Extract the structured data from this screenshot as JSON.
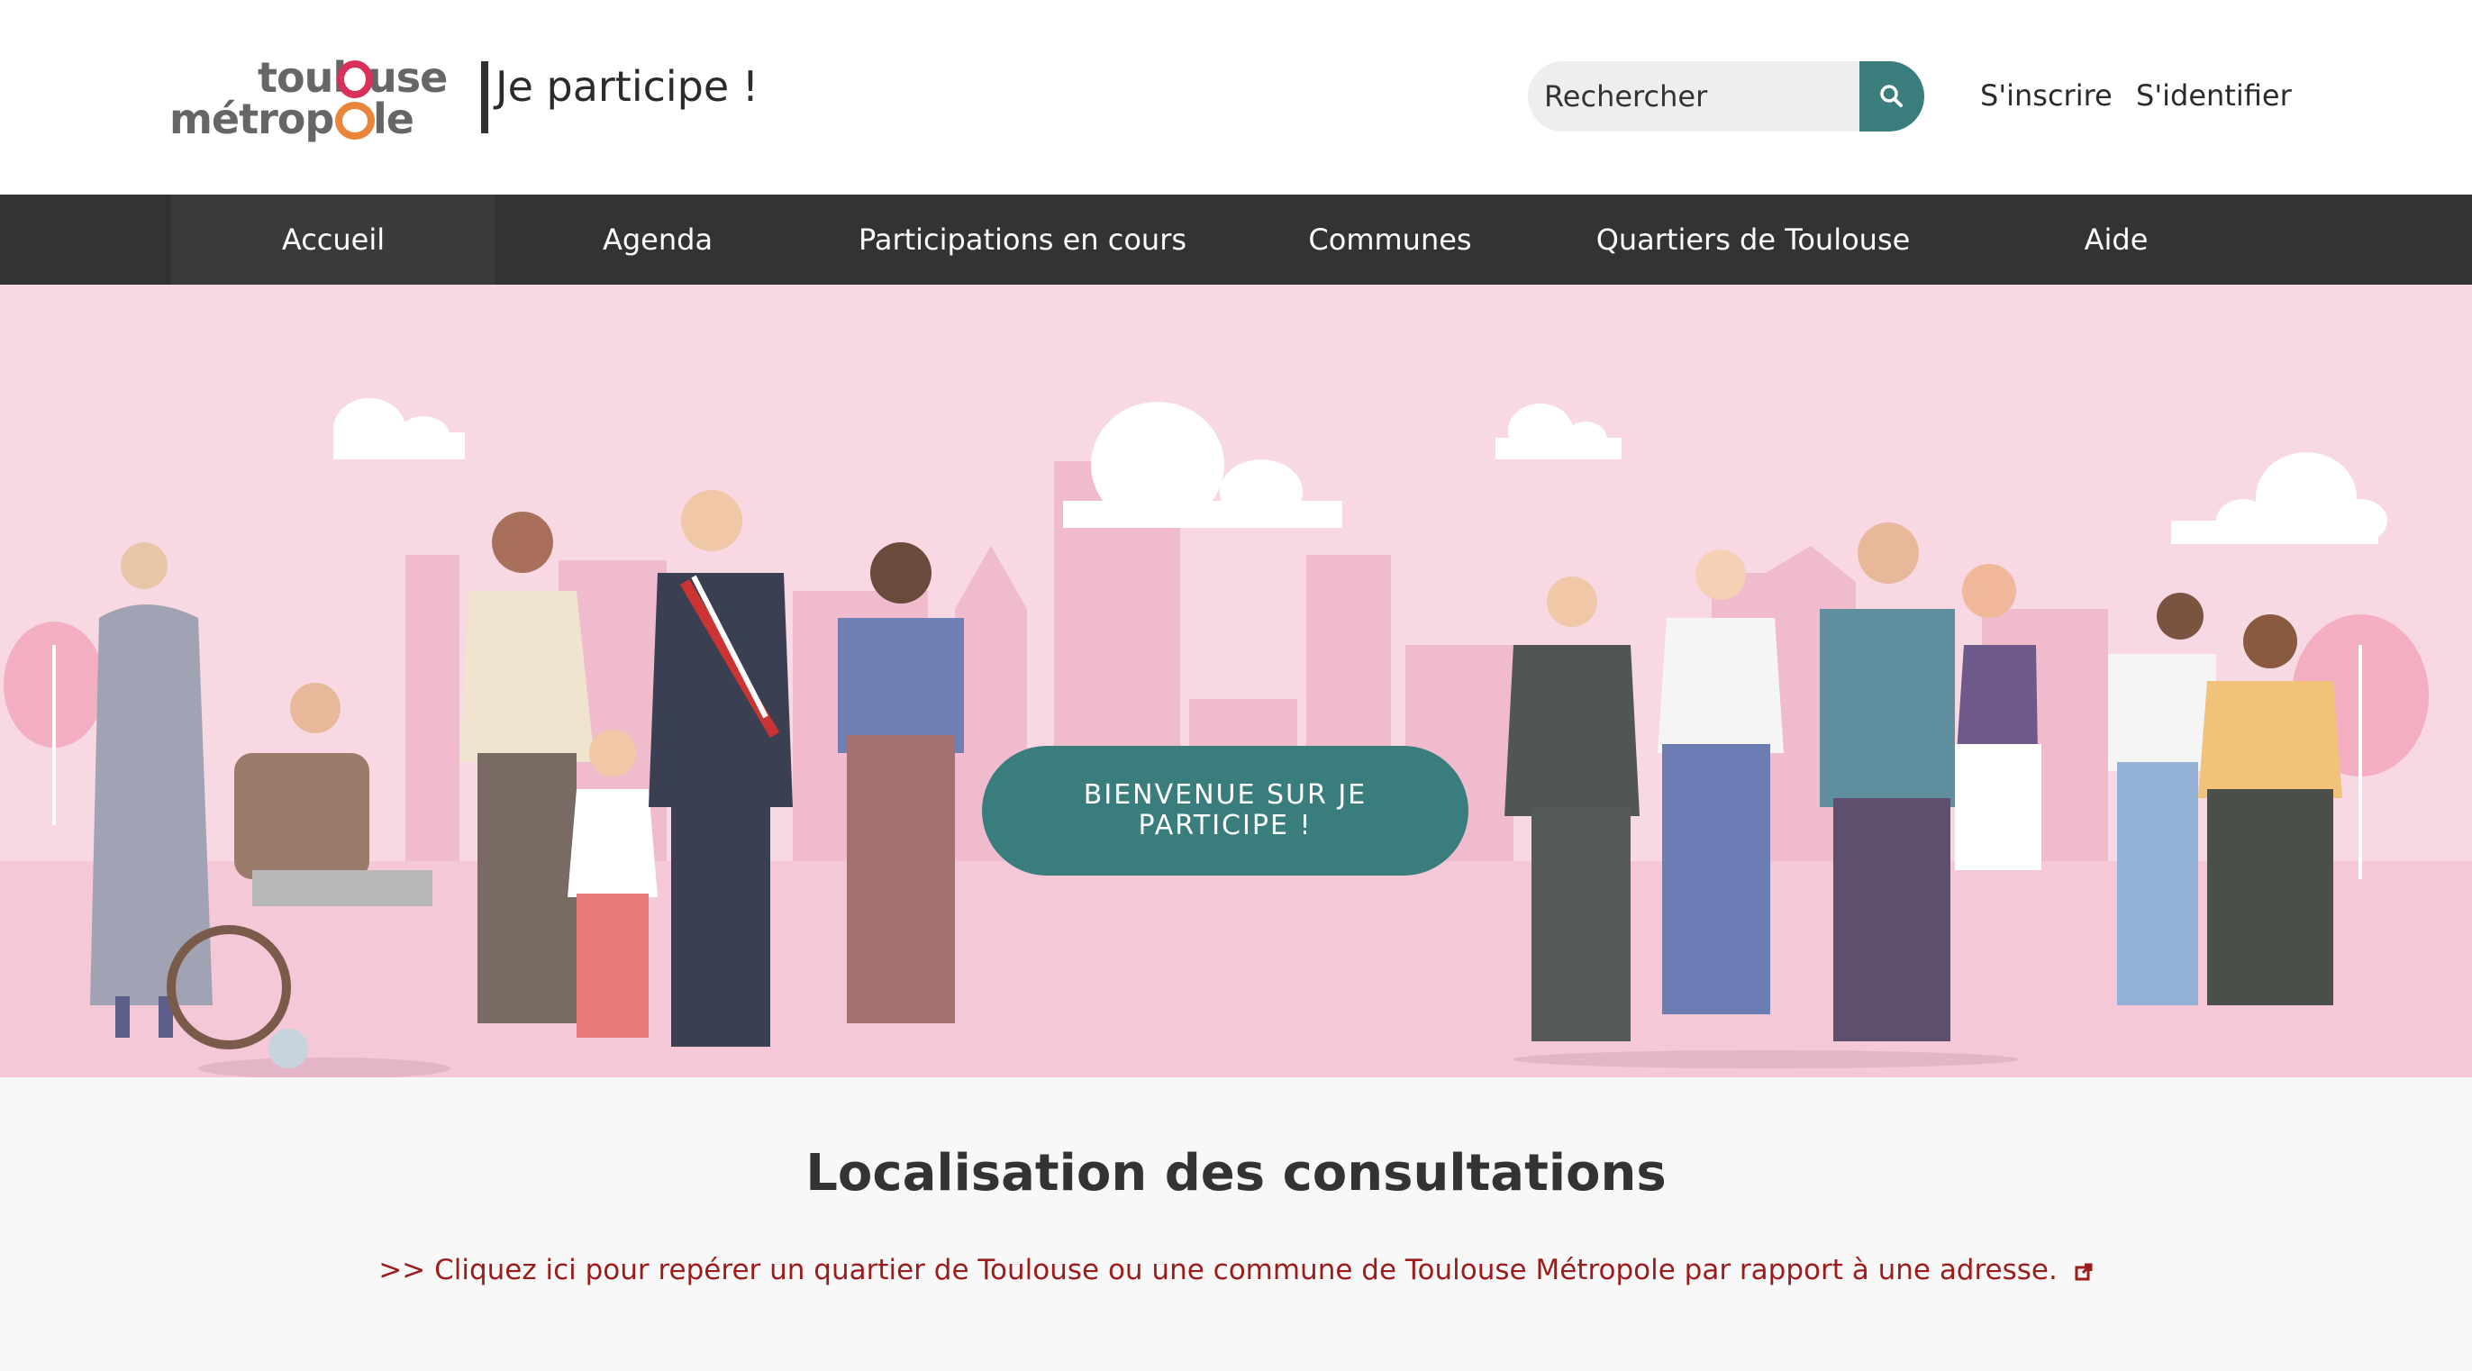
{
  "header": {
    "logo": {
      "line1": "toulouse",
      "line2": "métropole"
    },
    "site_title": "Je participe !",
    "search": {
      "placeholder": "Rechercher",
      "icon": "search-icon"
    },
    "auth": {
      "register": "S'inscrire",
      "login": "S'identifier"
    }
  },
  "nav": {
    "items": [
      {
        "label": "Accueil",
        "active": true
      },
      {
        "label": "Agenda"
      },
      {
        "label": "Participations en cours"
      },
      {
        "label": "Communes"
      },
      {
        "label": "Quartiers de Toulouse"
      },
      {
        "label": "Aide"
      }
    ]
  },
  "hero": {
    "button_label": "BIENVENUE SUR JE PARTICIPE !",
    "illustration": "group-of-diverse-people-illustration"
  },
  "section": {
    "title": "Localisation des consultations",
    "link_text": ">> Cliquez ici pour repérer un quartier de Toulouse ou une commune de Toulouse Métropole par rapport à une adresse.",
    "link_icon": "external-link-icon"
  },
  "colors": {
    "accent": "#3a7d7d",
    "nav_bg": "#333333",
    "hero_bg": "#f7d8e3",
    "link": "#9c1c1c",
    "logo_accent": "#d9315a"
  }
}
